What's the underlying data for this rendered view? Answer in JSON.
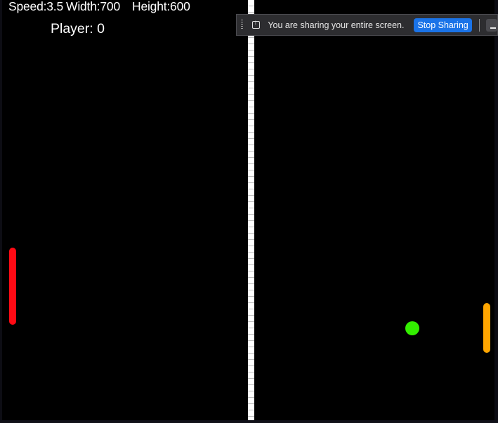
{
  "hud": {
    "speed": "Speed:3.5",
    "width": "Width:700",
    "height": "Height:600",
    "player_score": "Player: 0"
  },
  "share_bar": {
    "message": "You are sharing your entire screen.",
    "stop_label": "Stop Sharing"
  },
  "colors": {
    "background": "#000000",
    "net": "#ffffff",
    "left_paddle": "#ff0a14",
    "right_paddle": "#ffa500",
    "ball": "#33ee00",
    "stop_button": "#1a73e8"
  }
}
